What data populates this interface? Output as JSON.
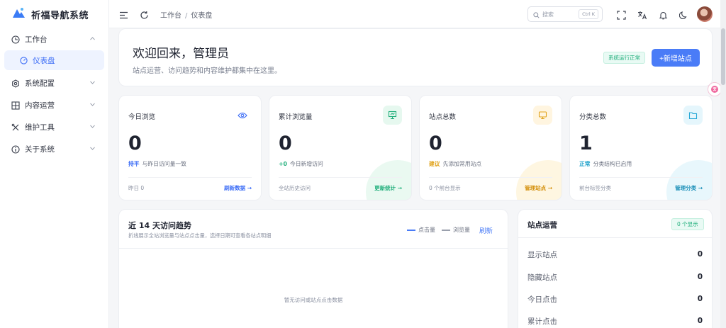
{
  "app": {
    "title": "祈福导航系统"
  },
  "sidebar": {
    "items": [
      {
        "label": "工作台",
        "icon": "dashboard-icon",
        "expanded": true
      },
      {
        "label": "仪表盘",
        "icon": "gauge-icon",
        "active": true
      },
      {
        "label": "系统配置",
        "icon": "settings-icon"
      },
      {
        "label": "内容运营",
        "icon": "grid-icon"
      },
      {
        "label": "维护工具",
        "icon": "tools-icon"
      },
      {
        "label": "关于系统",
        "icon": "info-icon"
      }
    ]
  },
  "topbar": {
    "breadcrumb": [
      "工作台",
      "仪表盘"
    ],
    "search": {
      "placeholder": "搜索",
      "shortcut": "Ctrl K"
    }
  },
  "welcome": {
    "title": "欢迎回来，管理员",
    "subtitle": "站点运营、访问趋势和内容维护都集中在这里。",
    "status": "系统运行正常",
    "add_button": "+新增站点"
  },
  "cards": [
    {
      "title": "今日浏览",
      "value": "0",
      "tag": "持平",
      "tag_color": "#3b6cf6",
      "hint": "与昨日访问量一致",
      "foot": "昨日 0",
      "link": "刷新数据 →",
      "link_color": "#3b6cf6",
      "icon": "eye-icon",
      "accent": "#3b6cf6",
      "icon_bg": "#ffffff",
      "blob": "#ffffff"
    },
    {
      "title": "累计浏览量",
      "value": "0",
      "tag": "+0",
      "tag_color": "#1fae7a",
      "hint": "今日新增访问",
      "foot": "全站历史访问",
      "link": "更新统计 →",
      "link_color": "#1fae7a",
      "icon": "presentation-icon",
      "accent": "#1fae7a",
      "icon_bg": "#e6f8ef",
      "blob": "#d8f4e6"
    },
    {
      "title": "站点总数",
      "value": "0",
      "tag": "建议",
      "tag_color": "#e0a21a",
      "hint": "先添加常用站点",
      "foot": "0 个前台显示",
      "link": "管理站点 →",
      "link_color": "#d48f0a",
      "icon": "monitor-icon",
      "accent": "#e0a21a",
      "icon_bg": "#fff5e0",
      "blob": "#fdeec8"
    },
    {
      "title": "分类总数",
      "value": "1",
      "tag": "正常",
      "tag_color": "#1a9fc9",
      "hint": "分类结构已启用",
      "foot": "前台标签分类",
      "link": "管理分类 →",
      "link_color": "#1a8fb8",
      "icon": "folder-icon",
      "accent": "#29a9d6",
      "icon_bg": "#e5f6fc",
      "blob": "#d6f0fa"
    }
  ],
  "trend": {
    "title": "近 14 天访问趋势",
    "subtitle": "折线展示全站浏览量与站点点击量，选择日期可查看各站点明细",
    "legend": [
      {
        "label": "点击量",
        "color": "#4a7cf7"
      },
      {
        "label": "浏览量",
        "color": "#9aa0ad"
      }
    ],
    "refresh": "刷新",
    "empty": "暂无访问或站点点击数据"
  },
  "ops": {
    "title": "站点运营",
    "badge": "0 个显示",
    "rows": [
      {
        "label": "显示站点",
        "value": "0"
      },
      {
        "label": "隐藏站点",
        "value": "0"
      },
      {
        "label": "今日点击",
        "value": "0"
      },
      {
        "label": "累计点击",
        "value": "0"
      }
    ]
  }
}
